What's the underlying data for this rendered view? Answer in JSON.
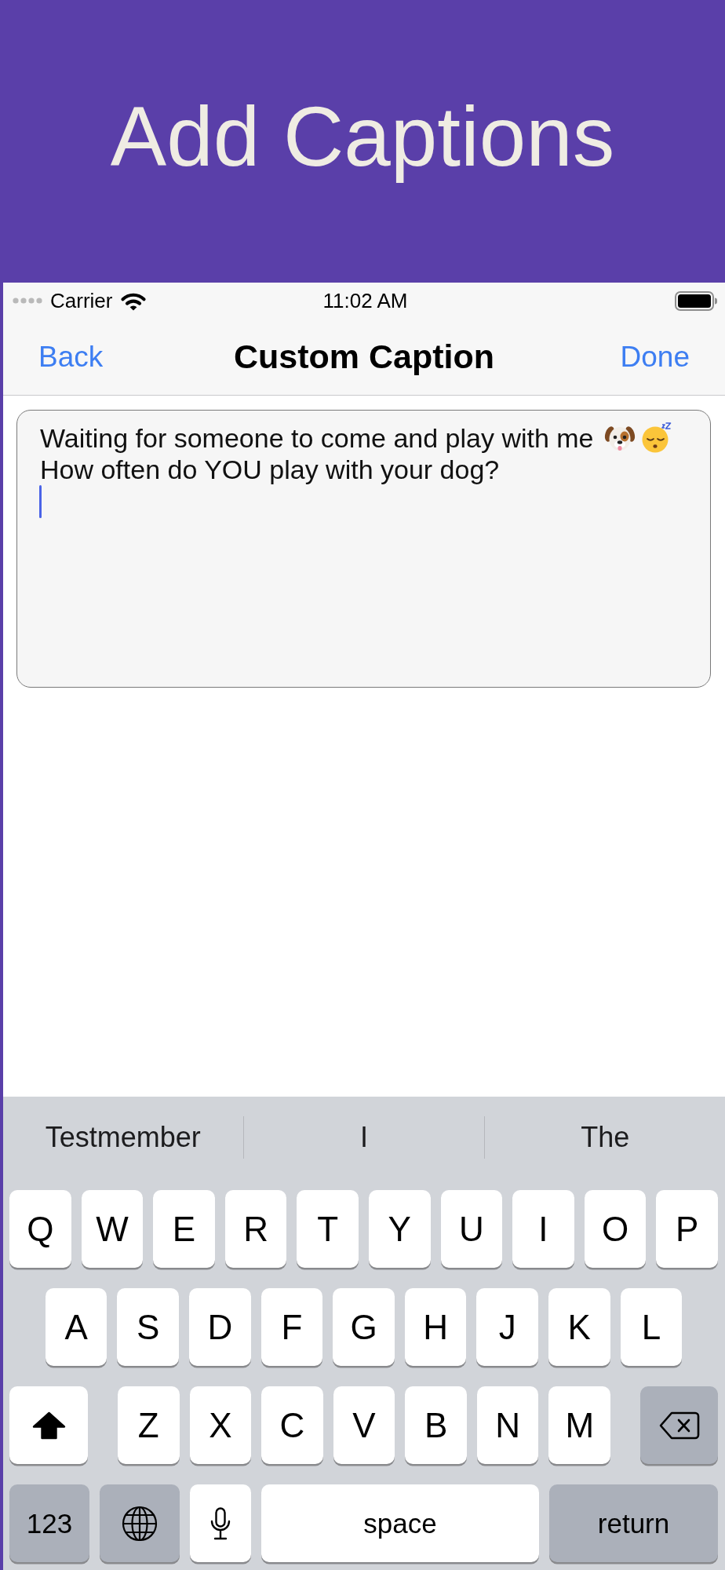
{
  "banner": {
    "title": "Add Captions"
  },
  "status_bar": {
    "carrier": "Carrier",
    "time": "11:02 AM"
  },
  "nav_bar": {
    "back": "Back",
    "title": "Custom Caption",
    "done": "Done"
  },
  "caption_field": {
    "focused": true,
    "lines": [
      {
        "text": "Waiting for someone to come and play with me",
        "emojis": [
          {
            "kind": "dog-face"
          },
          {
            "kind": "sleeping-face"
          }
        ]
      },
      {
        "text": "How often do YOU play with your dog?"
      }
    ]
  },
  "keyboard": {
    "suggestions": [
      {
        "label": "Testmember"
      },
      {
        "label": "I"
      },
      {
        "label": "The"
      }
    ],
    "rows": [
      {
        "keys": [
          {
            "kind": "letter",
            "label": "Q"
          },
          {
            "kind": "letter",
            "label": "W"
          },
          {
            "kind": "letter",
            "label": "E"
          },
          {
            "kind": "letter",
            "label": "R"
          },
          {
            "kind": "letter",
            "label": "T"
          },
          {
            "kind": "letter",
            "label": "Y"
          },
          {
            "kind": "letter",
            "label": "U"
          },
          {
            "kind": "letter",
            "label": "I"
          },
          {
            "kind": "letter",
            "label": "O"
          },
          {
            "kind": "letter",
            "label": "P"
          }
        ]
      },
      {
        "keys": [
          {
            "kind": "letter",
            "label": "A"
          },
          {
            "kind": "letter",
            "label": "S"
          },
          {
            "kind": "letter",
            "label": "D"
          },
          {
            "kind": "letter",
            "label": "F"
          },
          {
            "kind": "letter",
            "label": "G"
          },
          {
            "kind": "letter",
            "label": "H"
          },
          {
            "kind": "letter",
            "label": "J"
          },
          {
            "kind": "letter",
            "label": "K"
          },
          {
            "kind": "letter",
            "label": "L"
          }
        ]
      },
      {
        "keys": [
          {
            "kind": "shift",
            "on": true
          },
          {
            "kind": "letter",
            "label": "Z"
          },
          {
            "kind": "letter",
            "label": "X"
          },
          {
            "kind": "letter",
            "label": "C"
          },
          {
            "kind": "letter",
            "label": "V"
          },
          {
            "kind": "letter",
            "label": "B"
          },
          {
            "kind": "letter",
            "label": "N"
          },
          {
            "kind": "letter",
            "label": "M"
          },
          {
            "kind": "backspace"
          }
        ]
      },
      {
        "keys": [
          {
            "kind": "numbers",
            "label": "123"
          },
          {
            "kind": "globe"
          },
          {
            "kind": "mic"
          },
          {
            "kind": "space",
            "label": "space"
          },
          {
            "kind": "return",
            "label": "return"
          }
        ]
      }
    ]
  }
}
